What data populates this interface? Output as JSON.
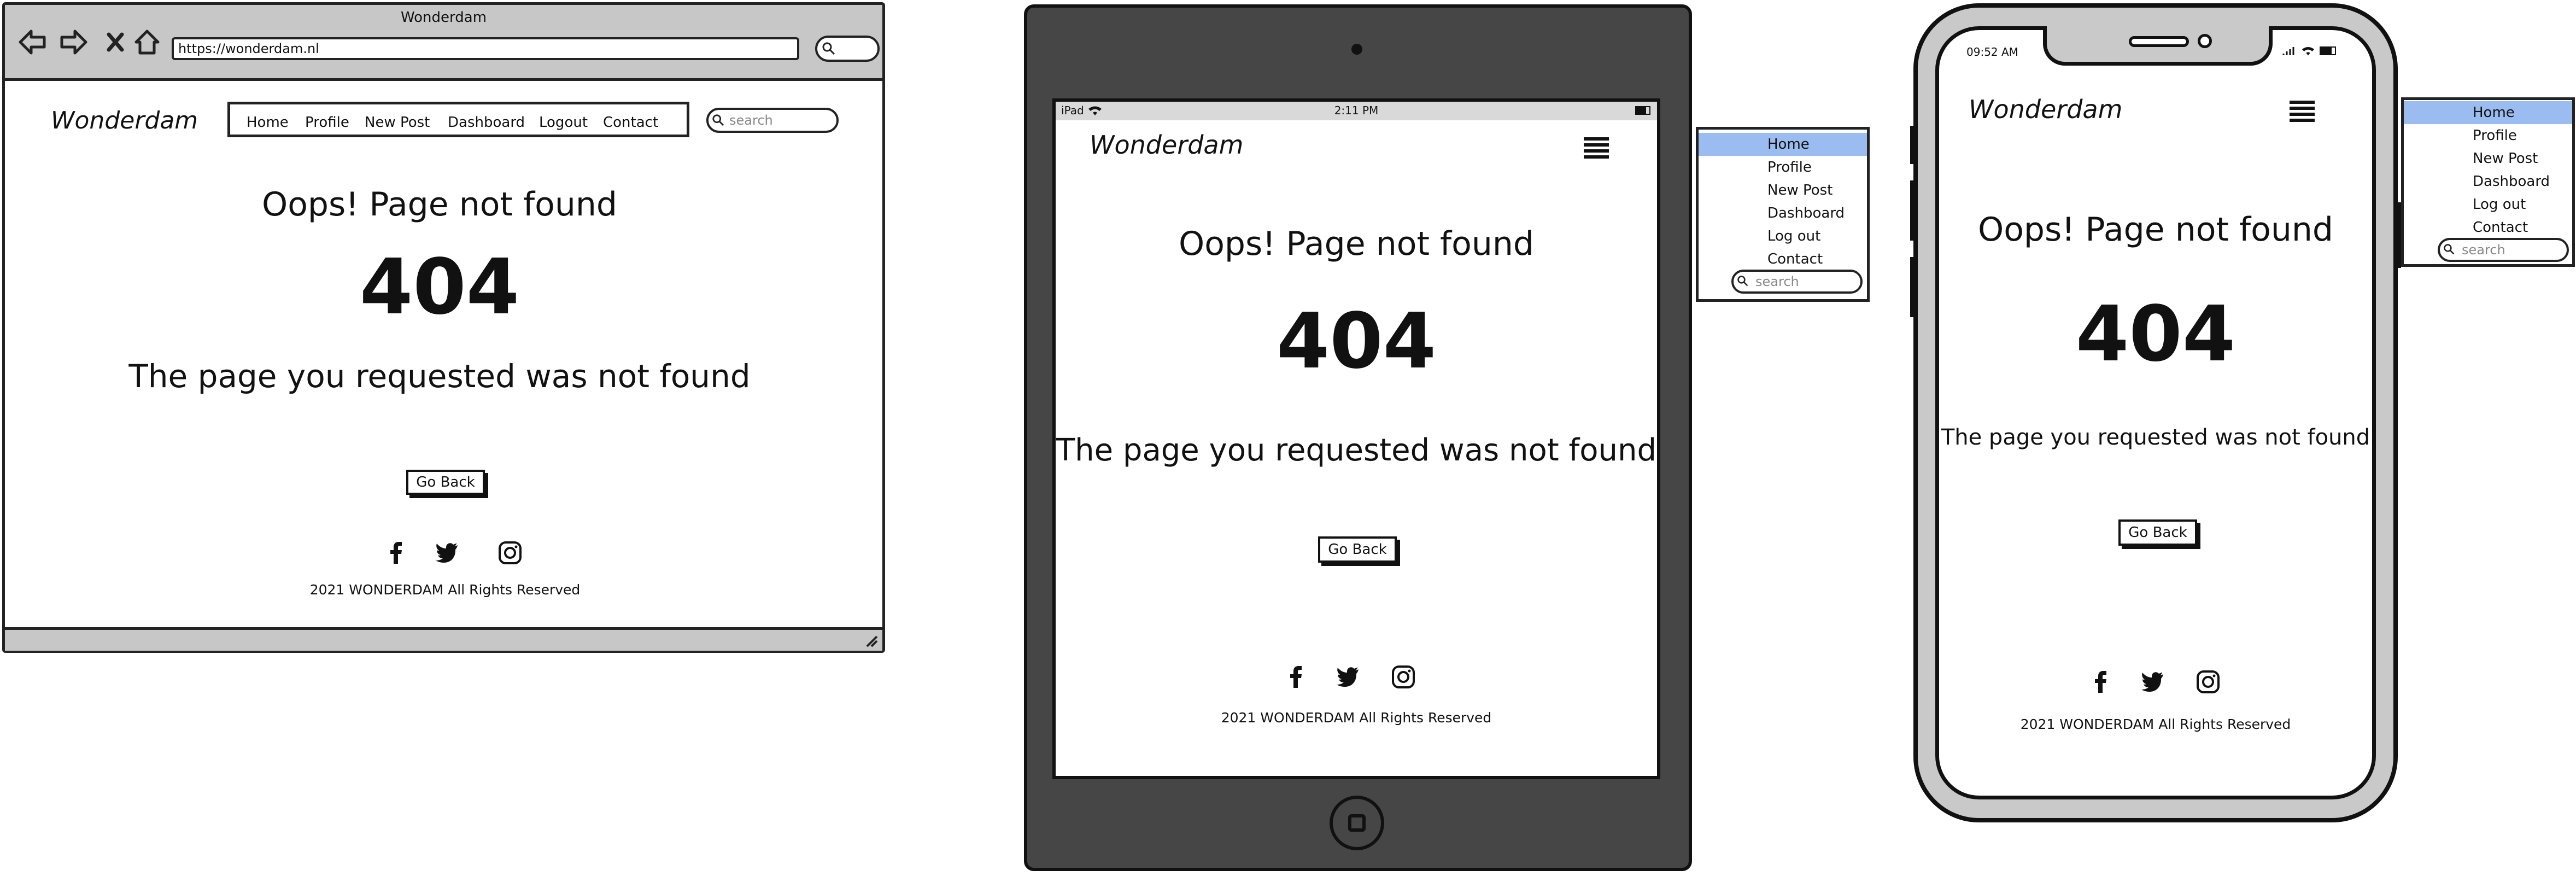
{
  "colors": {
    "device_dark": "#464646",
    "chrome_gray": "#c7c7c7",
    "menu_active": "#9bbcf0"
  },
  "desktop": {
    "window_title": "Wonderdam",
    "url": "https://wonderdam.nl",
    "logo": "Wonderdam",
    "nav": [
      "Home",
      "Profile",
      "New Post",
      "Dashboard",
      "Logout",
      "Contact"
    ],
    "search_placeholder": "search",
    "heading": "Oops! Page not found",
    "code": "404",
    "message": "The page you requested was not found",
    "button": "Go Back",
    "footer": "2021 WONDERDAM All Rights Reserved",
    "icons": [
      "back-arrow-icon",
      "forward-arrow-icon",
      "close-icon",
      "home-icon",
      "facebook-icon",
      "twitter-icon",
      "instagram-icon"
    ]
  },
  "tablet": {
    "status_left": "iPad",
    "status_time": "2:11 PM",
    "logo": "Wonderdam",
    "heading": "Oops! Page not found",
    "code": "404",
    "message": "The page you requested was not found",
    "button": "Go Back",
    "footer": "2021 WONDERDAM All Rights Reserved",
    "menu": [
      "Home",
      "Profile",
      "New Post",
      "Dashboard",
      "Log out",
      "Contact"
    ],
    "menu_search": "search"
  },
  "phone": {
    "status_time": "09:52 AM",
    "logo": "Wonderdam",
    "heading": "Oops! Page not found",
    "code": "404",
    "message": "The page you requested was not found",
    "button": "Go Back",
    "footer": "2021 WONDERDAM All Rights Reserved",
    "menu": [
      "Home",
      "Profile",
      "New Post",
      "Dashboard",
      "Log out",
      "Contact"
    ],
    "menu_search": "search"
  }
}
